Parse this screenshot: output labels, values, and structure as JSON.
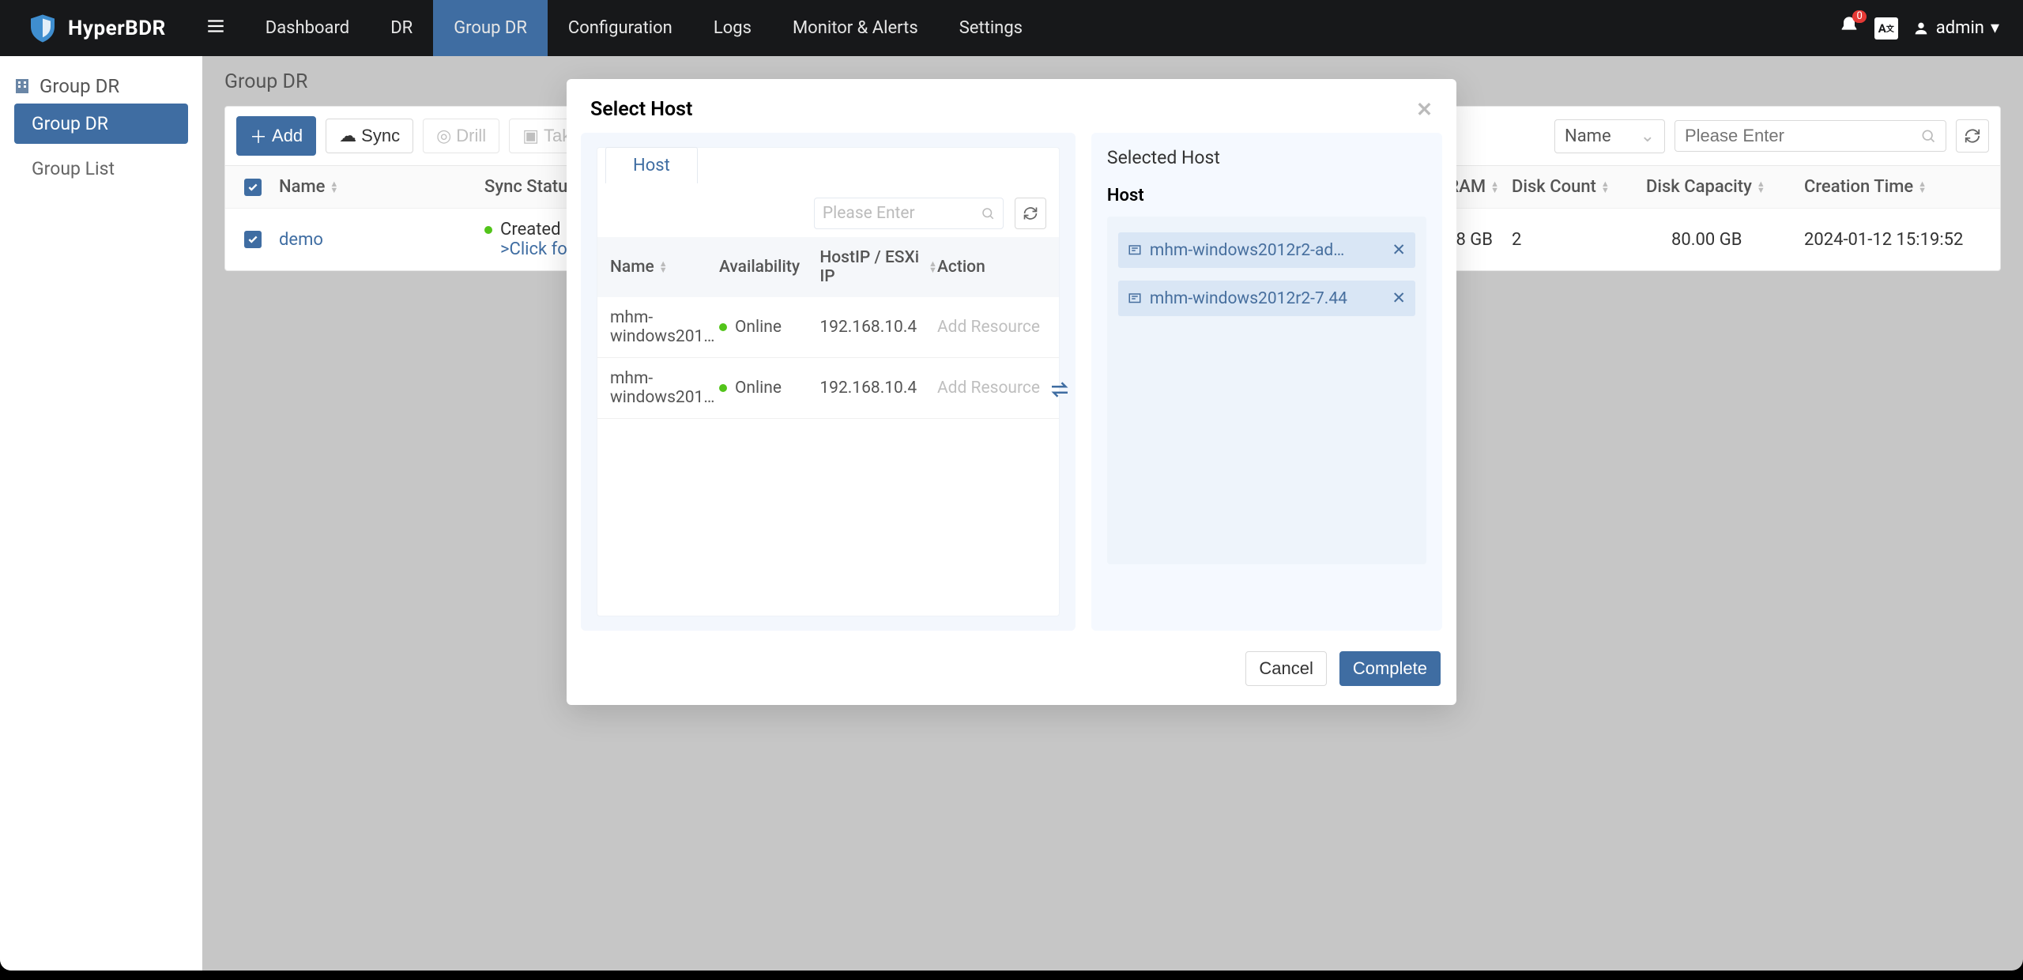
{
  "brand": "HyperBDR",
  "nav": {
    "items": [
      "Dashboard",
      "DR",
      "Group DR",
      "Configuration",
      "Logs",
      "Monitor & Alerts",
      "Settings"
    ],
    "activeIndex": 2
  },
  "topRight": {
    "badge": "0",
    "lang": "A",
    "user": "admin"
  },
  "sidebar": {
    "title": "Group DR",
    "items": [
      {
        "label": "Group DR",
        "active": true
      },
      {
        "label": "Group List",
        "active": false
      }
    ]
  },
  "crumb": "Group DR",
  "toolbar": {
    "add": "Add",
    "sync": "Sync",
    "drill": "Drill",
    "takeover": "Takeover",
    "select_label": "Name",
    "search_placeholder": "Please Enter"
  },
  "table": {
    "cols": [
      "",
      "Name",
      "Sync Status",
      "",
      "Total RAM",
      "Disk Count",
      "Disk Capacity",
      "Creation Time"
    ],
    "row": {
      "name": "demo",
      "status_line1": "Created",
      "status_line2": ">Click fo",
      "ram": "8 GB",
      "disk_count": "2",
      "disk_cap": "80.00 GB",
      "created": "2024-01-12 15:19:52"
    }
  },
  "modal": {
    "title": "Select Host",
    "tab": "Host",
    "search_placeholder": "Please Enter",
    "cols": {
      "name": "Name",
      "avail": "Availability",
      "ip": "HostIP / ESXi IP",
      "action": "Action"
    },
    "rows": [
      {
        "name": "mhm-windows201…",
        "avail": "Online",
        "ip": "192.168.10.4",
        "action": "Add Resource"
      },
      {
        "name": "mhm-windows201…",
        "avail": "Online",
        "ip": "192.168.10.4",
        "action": "Add Resource"
      }
    ],
    "selected_title": "Selected Host",
    "selected_sub": "Host",
    "selected": [
      "mhm-windows2012r2-ad…",
      "mhm-windows2012r2-7.44"
    ],
    "cancel": "Cancel",
    "complete": "Complete"
  }
}
